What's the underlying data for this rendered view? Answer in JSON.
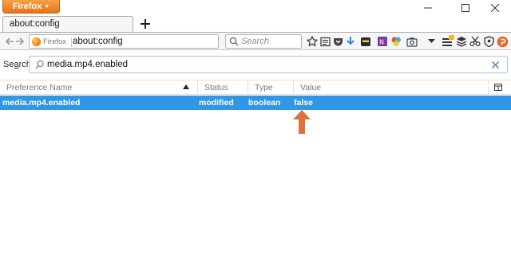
{
  "browser": {
    "menu_button_label": "Firefox",
    "active_tab_title": "about:config",
    "identity_label": "Firefox",
    "url": "about:config",
    "search_placeholder": "Search"
  },
  "toolbar_icons": [
    "bookmark-star-icon",
    "reading-list-icon",
    "pocket-icon",
    "download-arrow-icon",
    "ninja-extension-icon",
    "onenote-clipper-icon",
    "color-wheel-icon",
    "screenshot-camera-icon",
    "overflow-caret-icon",
    "hamburger-menu-icon",
    "layers-icon",
    "scissors-icon",
    "shield-icon",
    "orange-addon-icon"
  ],
  "about_config": {
    "search_label_prefix": "Se",
    "search_label_accesskey": "a",
    "search_label_suffix": "rch:",
    "search_value": "media.mp4.enabled",
    "columns": {
      "name": "Preference Name",
      "status": "Status",
      "type": "Type",
      "value": "Value"
    },
    "rows": [
      {
        "name": "media.mp4.enabled",
        "status": "modified",
        "type": "boolean",
        "value": "false"
      }
    ]
  },
  "colors": {
    "firefox_button": "#e8741a",
    "selection": "#3296e6",
    "annotation_arrow": "#e0703e"
  }
}
